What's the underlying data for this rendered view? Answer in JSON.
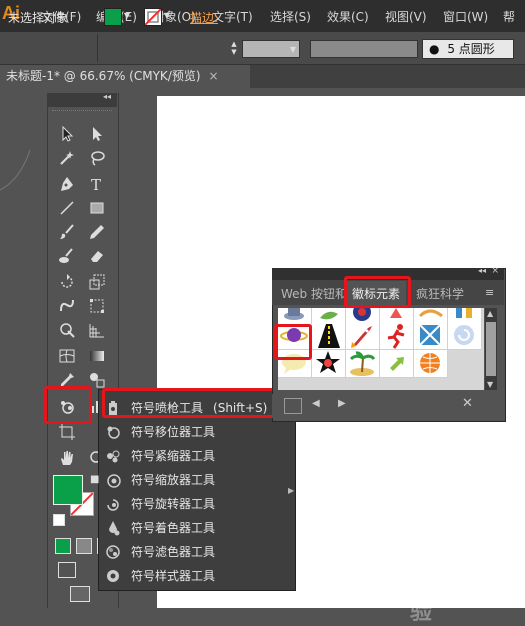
{
  "app": {
    "logo": "Ai"
  },
  "menu": [
    "文件(F)",
    "编辑(E)",
    "对象(O)",
    "文字(T)",
    "选择(S)",
    "效果(C)",
    "视图(V)",
    "窗口(W)",
    "帮"
  ],
  "control_bar": {
    "selection_label": "未选择对象",
    "stroke_label": "描边:",
    "brush_label": "5 点圆形",
    "fill_color": "#0aa04a"
  },
  "document": {
    "tab_title": "未标题-1* @ 66.67% (CMYK/预览)",
    "close": "×"
  },
  "tools_flyout": {
    "items": [
      {
        "label": "符号喷枪工具",
        "shortcut": "(Shift+S)",
        "icon": "symbol-sprayer-icon"
      },
      {
        "label": "符号移位器工具",
        "shortcut": "",
        "icon": "symbol-shifter-icon"
      },
      {
        "label": "符号紧缩器工具",
        "shortcut": "",
        "icon": "symbol-scruncher-icon"
      },
      {
        "label": "符号缩放器工具",
        "shortcut": "",
        "icon": "symbol-sizer-icon"
      },
      {
        "label": "符号旋转器工具",
        "shortcut": "",
        "icon": "symbol-spinner-icon"
      },
      {
        "label": "符号着色器工具",
        "shortcut": "",
        "icon": "symbol-stainer-icon"
      },
      {
        "label": "符号滤色器工具",
        "shortcut": "",
        "icon": "symbol-screener-icon"
      },
      {
        "label": "符号样式器工具",
        "shortcut": "",
        "icon": "symbol-styler-icon"
      }
    ]
  },
  "symbols_panel": {
    "tabs": [
      "Web 按钮和",
      "徽标元素",
      "疯狂科学"
    ],
    "active_tab": "徽标元素",
    "menu_icon": "panel-menu-icon"
  },
  "watermark": "Baidu 经验",
  "colors": {
    "highlight": "#e5151c",
    "fill_green": "#0aa04a"
  }
}
